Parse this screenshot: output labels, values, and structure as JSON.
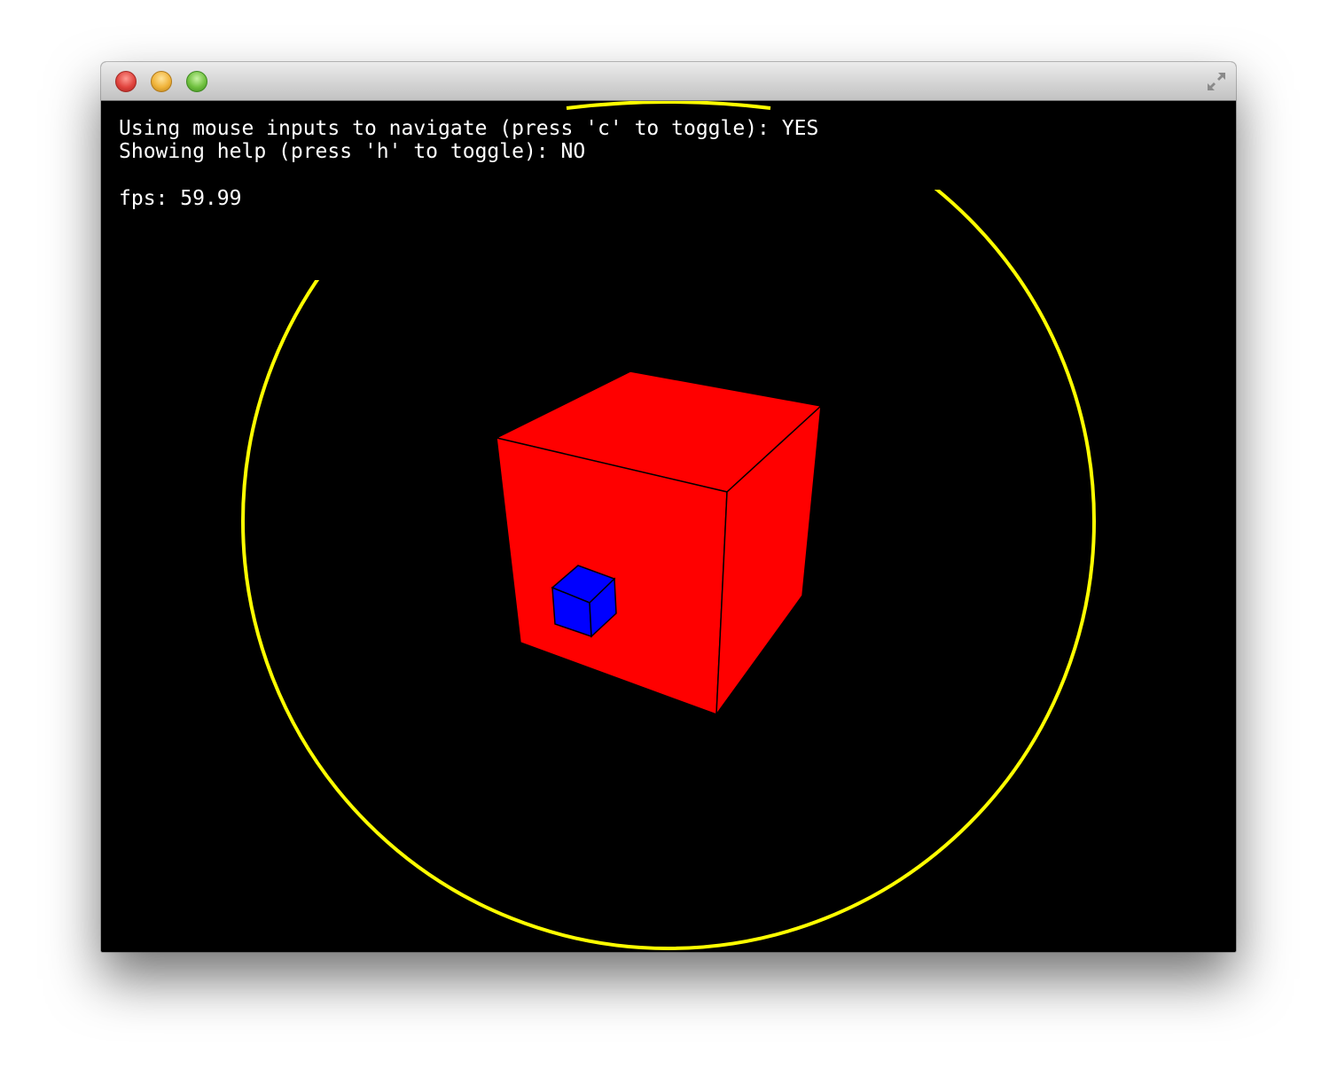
{
  "window": {
    "controls": {
      "close": "close-icon",
      "minimize": "minimize-icon",
      "zoom": "zoom-icon",
      "fullscreen": "fullscreen-icon"
    }
  },
  "hud": {
    "line1": "Using mouse inputs to navigate (press 'c' to toggle): YES",
    "line2": "Showing help (press 'h' to toggle): NO",
    "fps": "fps: 59.99"
  },
  "scene": {
    "background_color": "#000000",
    "ring_color": "#ffff00",
    "large_cube_color": "#ff0000",
    "small_cube_color": "#0000ff",
    "edge_color": "#000000"
  }
}
